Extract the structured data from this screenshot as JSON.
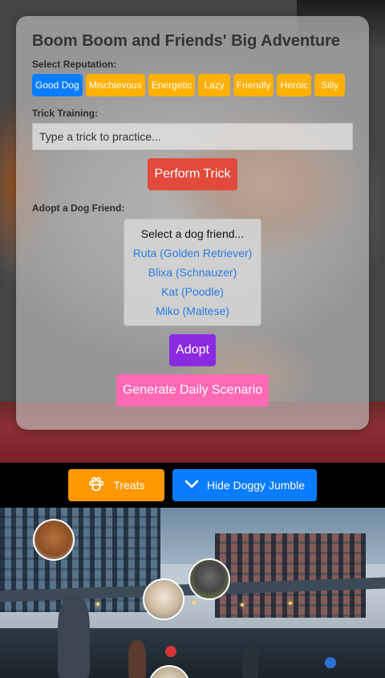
{
  "card": {
    "title": "Boom Boom and Friends' Big Adventure",
    "reputation_label": "Select Reputation:",
    "reputations": [
      "Good Dog",
      "Mischievous",
      "Energetic",
      "Lazy",
      "Friendly",
      "Heroic",
      "Silly"
    ],
    "selected_reputation": "Good Dog",
    "trick_label": "Trick Training:",
    "trick_placeholder": "Type a trick to practice...",
    "perform_label": "Perform Trick",
    "adopt_label_heading": "Adopt a Dog Friend:",
    "dog_select_header": "Select a dog friend...",
    "dog_options": [
      "Ruta (Golden Retriever)",
      "Blixa (Schnauzer)",
      "Kat (Poodle)",
      "Miko (Maltese)"
    ],
    "adopt_button": "Adopt",
    "scenario_button": "Generate Daily Scenario"
  },
  "toolbar": {
    "treats_label": "Treats",
    "jumble_label": "Hide Doggy Jumble",
    "treats_icon": "paw-icon",
    "jumble_icon": "chevron-down-icon"
  },
  "colors": {
    "active_reputation": "#0a7cff",
    "reputation": "#ffb000",
    "perform": "#e24a3b",
    "adopt": "#8a2be2",
    "scenario": "#ff69b4",
    "treats": "#ff9800",
    "jumble": "#0a7cff"
  }
}
